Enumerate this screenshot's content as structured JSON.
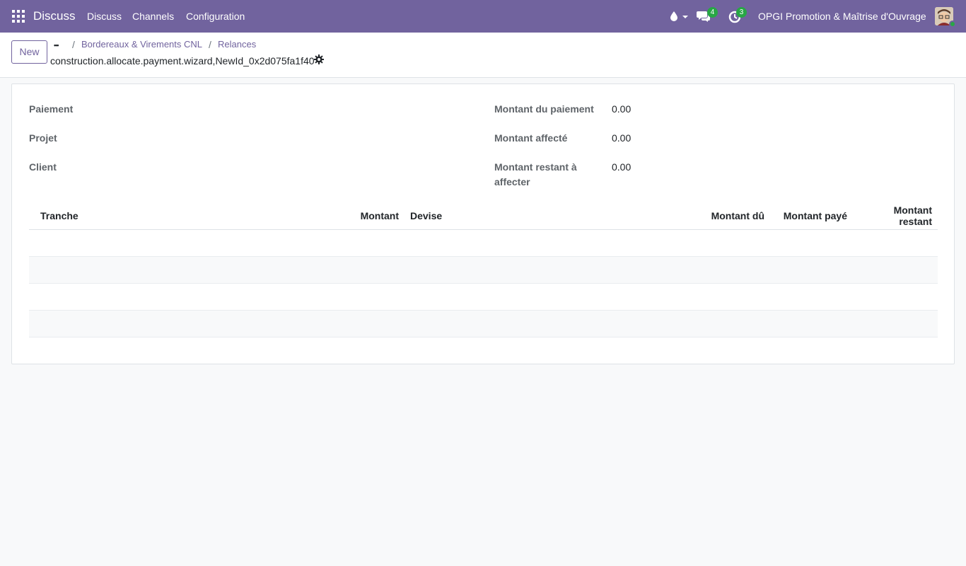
{
  "navbar": {
    "brand": "Discuss",
    "menus": [
      "Discuss",
      "Channels",
      "Configuration"
    ],
    "messages_badge": "4",
    "activity_badge": "3",
    "company": "OPGI Promotion & Maîtrise d'Ouvrage",
    "accent_color": "#71639e"
  },
  "control_panel": {
    "new_label": "New",
    "dots": "•••",
    "breadcrumbs": [
      "Bordereaux & Virements CNL",
      "Relances"
    ],
    "record_name": "construction.allocate.payment.wizard,NewId_0x2d075fa1f40"
  },
  "form": {
    "left_labels": [
      "Paiement",
      "Projet",
      "Client"
    ],
    "right_fields": [
      {
        "label": "Montant du paiement",
        "value": "0.00"
      },
      {
        "label": "Montant affecté",
        "value": "0.00"
      },
      {
        "label": "Montant restant à affecter",
        "value": "0.00"
      }
    ]
  },
  "table": {
    "headers": [
      "Tranche",
      "Montant",
      "Devise",
      "Montant dû",
      "Montant payé",
      "Montant restant"
    ]
  }
}
